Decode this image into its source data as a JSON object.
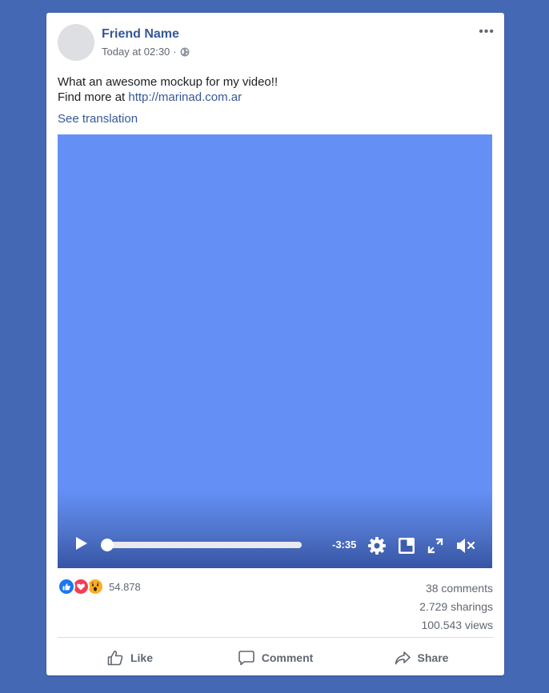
{
  "post": {
    "author_name": "Friend Name",
    "timestamp": "Today at 02:30",
    "separator": "·",
    "audience_icon": "globe-icon",
    "more_label": "•••",
    "text_line1": "What an awesome mockup for my video!!",
    "text_line2_prefix": "Find more at ",
    "link_text": "http://marinad.com.ar",
    "see_translation": "See translation"
  },
  "video": {
    "time_remaining": "-3:35",
    "progress": 0.0,
    "background_color": "#6490f6",
    "icons": [
      "play-icon",
      "gear-icon",
      "miniplayer-icon",
      "fullscreen-icon",
      "mute-icon"
    ]
  },
  "reactions": {
    "icons": [
      "like-reaction-icon",
      "love-reaction-icon",
      "wow-reaction-icon"
    ],
    "count": "54.878"
  },
  "stats": {
    "comments": "38 comments",
    "sharings": "2.729 sharings",
    "views": "100.543 views"
  },
  "actions": {
    "like": "Like",
    "comment": "Comment",
    "share": "Share"
  },
  "colors": {
    "page_background": "#4468b3",
    "link": "#365899",
    "like_blue": "#1877f2",
    "love_red": "#f33e58",
    "wow_yellow": "#f7b125"
  }
}
